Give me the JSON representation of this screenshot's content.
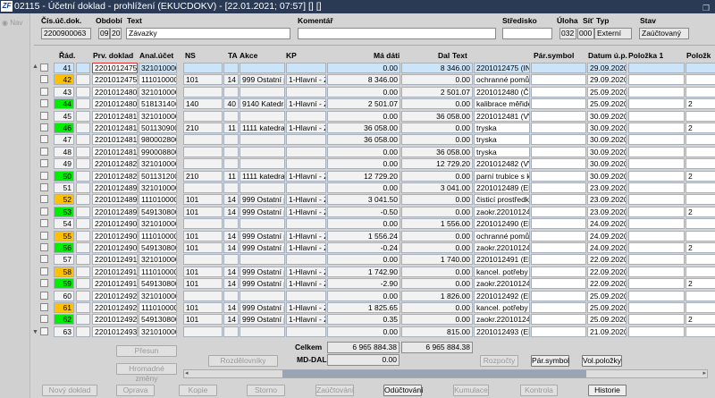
{
  "window": {
    "title": "02115 - Účetní doklad - prohlížení (EKUCDOKV) - [22.01.2021; 07:57] [] []",
    "logo": "ZF"
  },
  "nav": {
    "label": "Nav"
  },
  "header": {
    "labels": {
      "cis": "Čís.úč.dok.",
      "obdobi": "Období",
      "text": "Text",
      "komentar": "Komentář",
      "stredisko": "Středisko",
      "uloha": "Úloha",
      "sit": "Síť",
      "typ": "Typ",
      "stav": "Stav"
    },
    "values": {
      "cis": "2200900063",
      "obdobi_m": "09",
      "obdobi_r": "20",
      "text": "Závazky",
      "komentar": "",
      "stredisko": "",
      "uloha": "032",
      "sit": "000",
      "typ": "Externí",
      "stav": "Zaúčtovaný"
    }
  },
  "columns": [
    "Řád.",
    "Prv. doklad",
    "Anal.účet",
    "NS",
    "TA",
    "Akce",
    "KP",
    "Má dáti",
    "Dal",
    "Text",
    "Pár.symbol",
    "Datum ú.p.",
    "Položka 1",
    "Položk"
  ],
  "status_colors": {
    "orange": "#ffc000",
    "green": "#00ee00"
  },
  "rows": [
    [
      "41",
      "",
      "2201012475",
      "321010000",
      "",
      "",
      "",
      "",
      "0.00",
      "8 346.00",
      "2201012475 (INTI",
      "",
      "29.09.2020",
      "",
      ""
    ],
    [
      "42",
      "orange",
      "2201012475",
      "111010000",
      "101",
      "14",
      "999 Ostatní pr",
      "1-Hlavní - Zá",
      "8 346.00",
      "0.00",
      "ochranné pomůck",
      "",
      "29.09.2020",
      "",
      ""
    ],
    [
      "43",
      "",
      "2201012480",
      "321010000",
      "",
      "",
      "",
      "",
      "0.00",
      "2 501.07",
      "2201012480 (ČES",
      "",
      "25.09.2020",
      "",
      ""
    ],
    [
      "44",
      "green",
      "2201012480",
      "518131406",
      "140",
      "40",
      "9140 Katedra",
      "1-Hlavní - Zá",
      "2 501.07",
      "0.00",
      "kalibrace měřidel",
      "",
      "25.09.2020",
      "",
      "2"
    ],
    [
      "45",
      "",
      "2201012481",
      "321010000",
      "",
      "",
      "",
      "",
      "0.00",
      "36 058.00",
      "2201012481 (VW",
      "",
      "30.09.2020",
      "",
      ""
    ],
    [
      "46",
      "green",
      "2201012481",
      "501130900",
      "210",
      "11",
      "1111 katedra",
      "1-Hlavní - Zá",
      "36 058.00",
      "0.00",
      "tryska",
      "",
      "30.09.2020",
      "",
      "2"
    ],
    [
      "47",
      "",
      "2201012481",
      "980002800",
      "",
      "",
      "",
      "",
      "36 058.00",
      "0.00",
      "tryska",
      "",
      "30.09.2020",
      "",
      ""
    ],
    [
      "48",
      "",
      "2201012481",
      "990008800",
      "",
      "",
      "",
      "",
      "0.00",
      "36 058.00",
      "tryska",
      "",
      "30.09.2020",
      "",
      ""
    ],
    [
      "49",
      "",
      "2201012482",
      "321010000",
      "",
      "",
      "",
      "",
      "0.00",
      "12 729.20",
      "2201012482 (VW",
      "",
      "30.09.2020",
      "",
      ""
    ],
    [
      "50",
      "green",
      "2201012482",
      "501131200",
      "210",
      "11",
      "1111 katedra",
      "1-Hlavní - Zá",
      "12 729.20",
      "0.00",
      "parní trubice s klip",
      "",
      "30.09.2020",
      "",
      "2"
    ],
    [
      "51",
      "",
      "2201012489",
      "321010000",
      "",
      "",
      "",
      "",
      "0.00",
      "3 041.00",
      "2201012489 (ERC",
      "",
      "23.09.2020",
      "",
      ""
    ],
    [
      "52",
      "orange",
      "2201012489",
      "111010000",
      "101",
      "14",
      "999 Ostatní pr",
      "1-Hlavní - Zá",
      "3 041.50",
      "0.00",
      "čisticí prostředky-",
      "",
      "23.09.2020",
      "",
      ""
    ],
    [
      "53",
      "green",
      "2201012489",
      "549130800",
      "101",
      "14",
      "999 Ostatní pr",
      "1-Hlavní - Zá",
      "-0.50",
      "0.00",
      "zaokr.220101248",
      "",
      "23.09.2020",
      "",
      "2"
    ],
    [
      "54",
      "",
      "2201012490",
      "321010000",
      "",
      "",
      "",
      "",
      "0.00",
      "1 556.00",
      "2201012490 (ERC",
      "",
      "24.09.2020",
      "",
      ""
    ],
    [
      "55",
      "orange",
      "2201012490",
      "111010000",
      "101",
      "14",
      "999 Ostatní pr",
      "1-Hlavní - Zá",
      "1 556.24",
      "0.00",
      "ochranné pomůck",
      "",
      "24.09.2020",
      "",
      ""
    ],
    [
      "56",
      "green",
      "2201012490",
      "549130800",
      "101",
      "14",
      "999 Ostatní pr",
      "1-Hlavní - Zá",
      "-0.24",
      "0.00",
      "zaokr.220101249",
      "",
      "24.09.2020",
      "",
      "2"
    ],
    [
      "57",
      "",
      "2201012491",
      "321010000",
      "",
      "",
      "",
      "",
      "0.00",
      "1 740.00",
      "2201012491 (ERC",
      "",
      "22.09.2020",
      "",
      ""
    ],
    [
      "58",
      "orange",
      "2201012491",
      "111010000",
      "101",
      "14",
      "999 Ostatní pr",
      "1-Hlavní - Zá",
      "1 742.90",
      "0.00",
      "kancel. potřeby -",
      "",
      "22.09.2020",
      "",
      ""
    ],
    [
      "59",
      "green",
      "2201012491",
      "549130800",
      "101",
      "14",
      "999 Ostatní pr",
      "1-Hlavní - Zá",
      "-2.90",
      "0.00",
      "zaokr.220101249",
      "",
      "22.09.2020",
      "",
      "2"
    ],
    [
      "60",
      "",
      "2201012492",
      "321010000",
      "",
      "",
      "",
      "",
      "0.00",
      "1 826.00",
      "2201012492 (ERC",
      "",
      "25.09.2020",
      "",
      ""
    ],
    [
      "61",
      "orange",
      "2201012492",
      "111010000",
      "101",
      "14",
      "999 Ostatní pr",
      "1-Hlavní - Zá",
      "1 825.65",
      "0.00",
      "kancel. potřeby -",
      "",
      "25.09.2020",
      "",
      ""
    ],
    [
      "62",
      "green",
      "2201012492",
      "549130800",
      "101",
      "14",
      "999 Ostatní pr",
      "1-Hlavní - Zá",
      "0.35",
      "0.00",
      "zaokr.220101249",
      "",
      "25.09.2020",
      "",
      "2"
    ],
    [
      "63",
      "",
      "2201012493",
      "321010000",
      "",
      "",
      "",
      "",
      "0.00",
      "815.00",
      "2201012493 (ERC",
      "",
      "21.09.2020",
      "",
      ""
    ]
  ],
  "totals": {
    "celkem_label": "Celkem",
    "md_dal_label": "MD-DAL",
    "celkem_md": "6 965 884.38",
    "celkem_dal": "6 965 884.38",
    "md_dal": "0.00"
  },
  "buttons": {
    "presun": "Přesun",
    "hromadne": "Hromadné změny",
    "rozdelovniky": "Rozdělovníky",
    "rozpocty": "Rozpočty",
    "par_symbol": "Pár.symbol",
    "vol_polozky": "Vol.položky",
    "novy": "Nový doklad",
    "oprava": "Oprava",
    "kopie": "Kopie",
    "storno": "Storno",
    "zauctovani": "Zaúčtování",
    "oductovani": "Odúčtování",
    "kumulace": "Kumulace",
    "kontrola": "Kontrola",
    "historie": "Historie"
  }
}
